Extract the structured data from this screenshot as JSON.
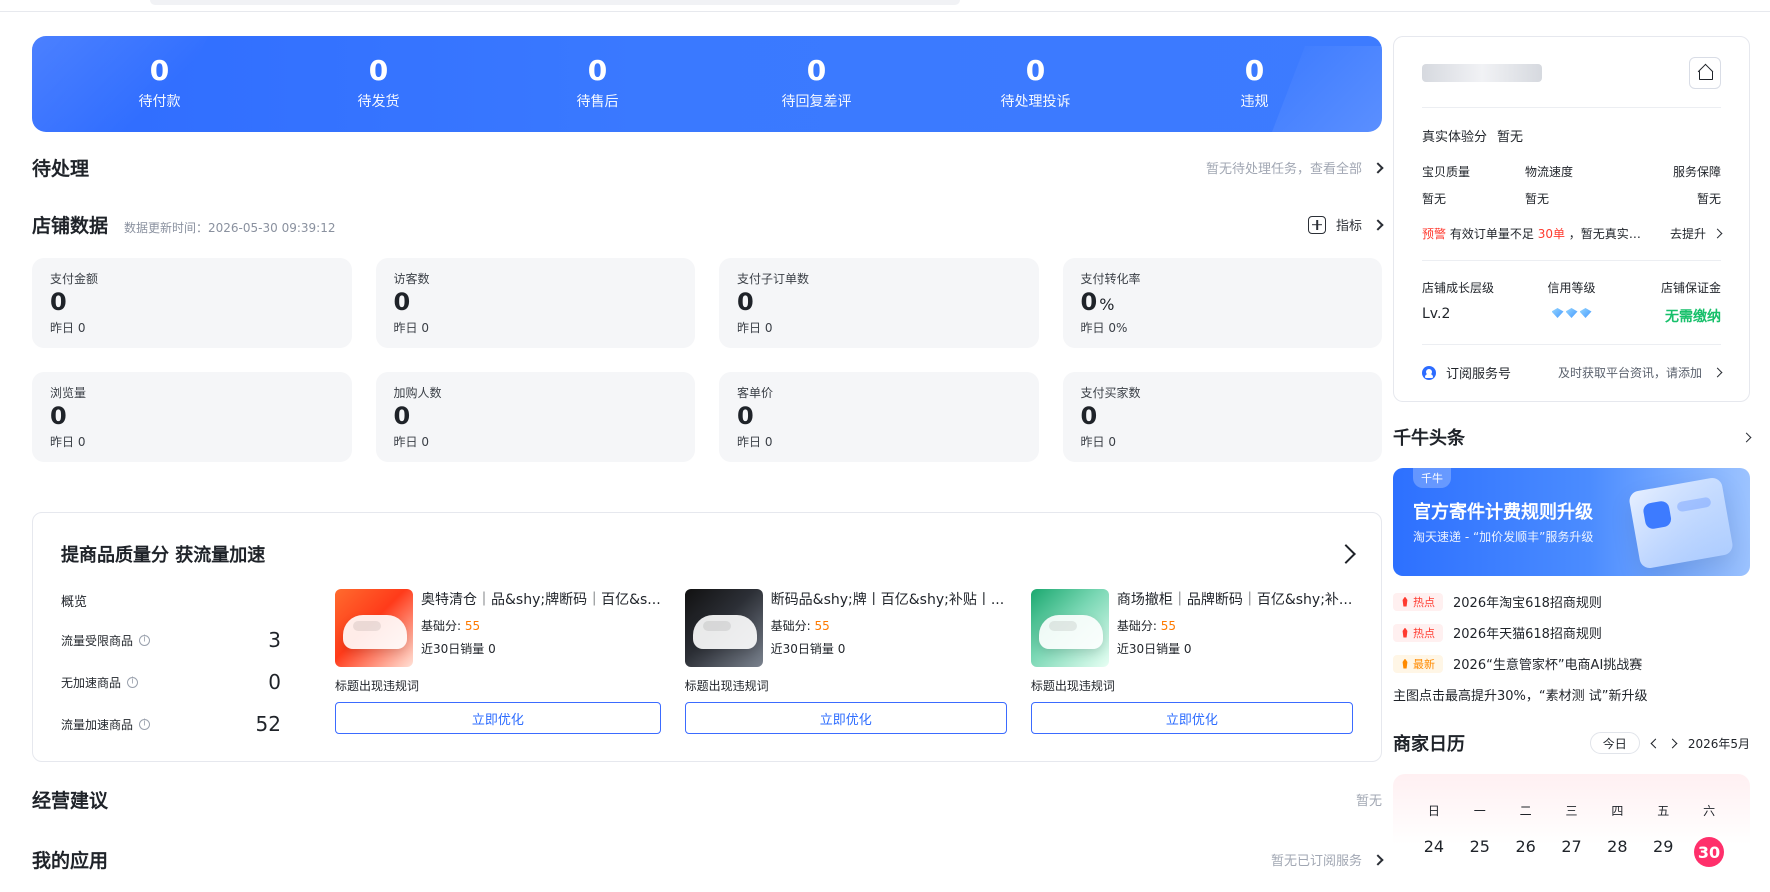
{
  "stats": [
    {
      "value": "0",
      "label": "待付款"
    },
    {
      "value": "0",
      "label": "待发货"
    },
    {
      "value": "0",
      "label": "待售后"
    },
    {
      "value": "0",
      "label": "待回复差评"
    },
    {
      "value": "0",
      "label": "待处理投诉"
    },
    {
      "value": "0",
      "label": "违规"
    }
  ],
  "pending": {
    "title": "待处理",
    "link": "暂无待处理任务，查看全部"
  },
  "shop_data": {
    "title": "店铺数据",
    "updated": "数据更新时间：2026-05-30 09:39:12",
    "indicator_label": "指标",
    "metrics": [
      {
        "title": "支付金额",
        "value": "0",
        "yesterday": "昨日 0",
        "pct": ""
      },
      {
        "title": "访客数",
        "value": "0",
        "yesterday": "昨日 0",
        "pct": ""
      },
      {
        "title": "支付子订单数",
        "value": "0",
        "yesterday": "昨日 0",
        "pct": ""
      },
      {
        "title": "支付转化率",
        "value": "0",
        "yesterday": "昨日 0%",
        "pct": "%"
      },
      {
        "title": "浏览量",
        "value": "0",
        "yesterday": "昨日 0",
        "pct": ""
      },
      {
        "title": "加购人数",
        "value": "0",
        "yesterday": "昨日 0",
        "pct": ""
      },
      {
        "title": "客单价",
        "value": "0",
        "yesterday": "昨日 0",
        "pct": ""
      },
      {
        "title": "支付买家数",
        "value": "0",
        "yesterday": "昨日 0",
        "pct": ""
      }
    ]
  },
  "quality": {
    "title": "提商品质量分 获流量加速",
    "overview_label": "概览",
    "overview_items": [
      {
        "name": "流量受限商品",
        "value": "3"
      },
      {
        "name": "无加速商品",
        "value": "0"
      },
      {
        "name": "流量加速商品",
        "value": "52"
      }
    ],
    "products": [
      {
        "title": "奥特清仓｜品&shy;牌断码｜百亿&s...",
        "base_label": "基础分:",
        "base_value": "55",
        "sales": "近30日销量 0",
        "note": "标题出现违规词",
        "button": "立即优化"
      },
      {
        "title": "断码品&shy;牌丨百亿&shy;补贴丨...",
        "base_label": "基础分:",
        "base_value": "55",
        "sales": "近30日销量 0",
        "note": "标题出现违规词",
        "button": "立即优化"
      },
      {
        "title": "商场撤柜｜品牌断码｜百亿&shy;补...",
        "base_label": "基础分:",
        "base_value": "55",
        "sales": "近30日销量 0",
        "note": "标题出现违规词",
        "button": "立即优化"
      }
    ]
  },
  "business_suggestion": {
    "title": "经营建议",
    "status": "暂无"
  },
  "my_apps": {
    "title": "我的应用",
    "status": "暂无已订阅服务"
  },
  "right_panel": {
    "store_name": "",
    "exp_label": "真实体验分",
    "exp_value": "暂无",
    "tri": [
      {
        "k": "宝贝质量",
        "v": "暂无"
      },
      {
        "k": "物流速度",
        "v": "暂无"
      },
      {
        "k": "服务保障",
        "v": "暂无"
      }
    ],
    "warn_prefix": "预警",
    "warn_text": "有效订单量不足",
    "warn_num": "30单",
    "warn_suffix": "，暂无真实体验分...",
    "warn_action": "去提升",
    "levels": [
      {
        "k": "店铺成长层级",
        "v": "Lv.2"
      },
      {
        "k": "信用等级",
        "v": ""
      },
      {
        "k": "店铺保证金",
        "v": "无需缴纳"
      }
    ],
    "subscribe_label": "订阅服务号",
    "subscribe_hint": "及时获取平台资讯，请添加",
    "qnh_title": "千牛头条",
    "banner_chip": "千牛",
    "banner_title": "官方寄件计费规则升级",
    "banner_sub": "淘天速递 - “加价发顺丰”服务升级",
    "news": [
      {
        "tag": "热点",
        "type": "hot",
        "text": "2026年淘宝618招商规则"
      },
      {
        "tag": "热点",
        "type": "hot",
        "text": "2026年天猫618招商规则"
      },
      {
        "tag": "最新",
        "type": "new",
        "text": "2026“生意管家杯”电商AI挑战赛"
      }
    ],
    "news_extra": "主图点击最高提升30%，“素材测 试”新升级",
    "calendar_title": "商家日历",
    "today": "今日",
    "month": "2026年5月",
    "weekdays": [
      "日",
      "一",
      "二",
      "三",
      "四",
      "五",
      "六"
    ],
    "days": [
      "24",
      "25",
      "26",
      "27",
      "28",
      "29",
      "30"
    ]
  },
  "colors": {
    "primary": "#2d6cff",
    "warning": "#ff3b30",
    "success": "#18c06b",
    "highlight": "#ff2f6b"
  }
}
